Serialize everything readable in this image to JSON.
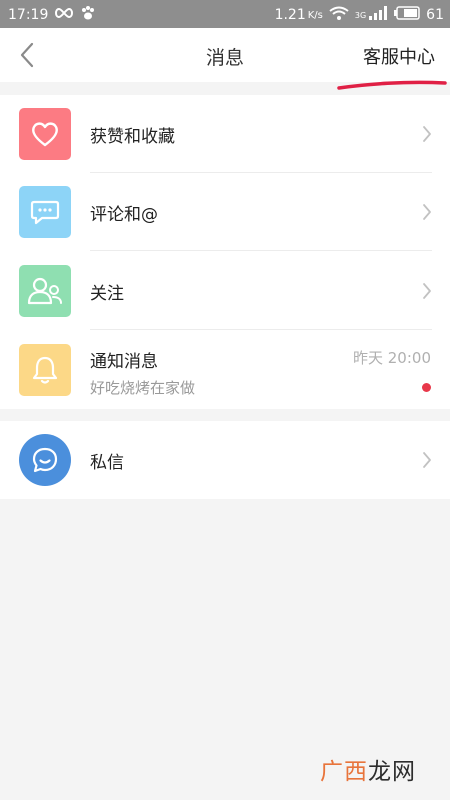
{
  "status_bar": {
    "time": "17:19",
    "net_speed": "1.21",
    "net_unit": "K/s",
    "network_type": "3G",
    "battery": "61"
  },
  "nav": {
    "title": "消息",
    "action_label": "客服中心"
  },
  "items": [
    {
      "label": "获赞和收藏",
      "icon": "heart-icon",
      "color": "#fc7b83"
    },
    {
      "label": "评论和@",
      "icon": "comment-icon",
      "color": "#8dd4f7"
    },
    {
      "label": "关注",
      "icon": "users-icon",
      "color": "#8fdfb1"
    },
    {
      "label": "通知消息",
      "subtitle": "好吃烧烤在家做",
      "time": "昨天 20:00",
      "icon": "bell-icon",
      "color": "#fcd887"
    }
  ],
  "private_message": {
    "label": "私信",
    "icon": "chat-bubble-icon",
    "color": "#4b8fdc"
  },
  "watermark": {
    "text": "广西龙网"
  },
  "colors": {
    "status_bar_bg": "#8e8e8e",
    "annotation_red": "#e02045",
    "unread_dot": "#e8384a"
  }
}
